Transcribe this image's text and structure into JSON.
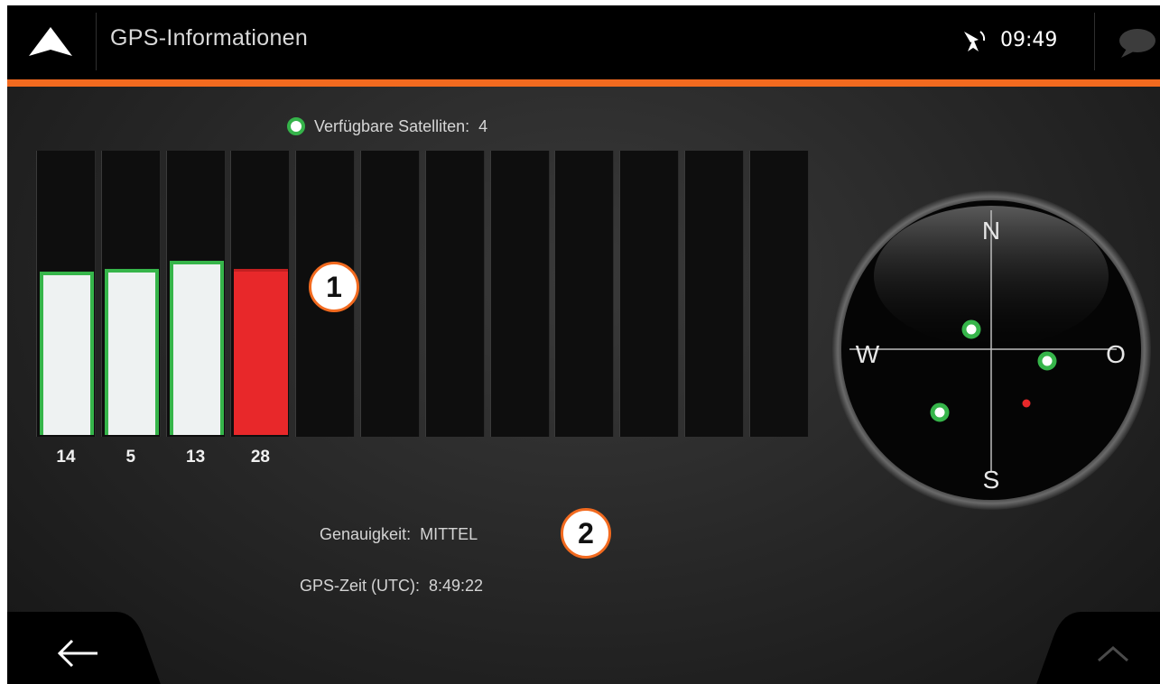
{
  "header": {
    "title": "GPS-Informationen",
    "clock": "09:49",
    "nav_icon": "navigation-arrow-icon",
    "satellite_icon": "satellite-icon",
    "message_icon": "speech-bubble-icon",
    "accent_color": "#f26a1f"
  },
  "satellites": {
    "available_label": "Verfügbare Satelliten:",
    "available_count": "4",
    "bars": [
      {
        "id": "14",
        "strength": 0.57,
        "status": "good"
      },
      {
        "id": "5",
        "strength": 0.58,
        "status": "good"
      },
      {
        "id": "13",
        "strength": 0.61,
        "status": "good"
      },
      {
        "id": "28",
        "strength": 0.58,
        "status": "weak"
      }
    ],
    "empty_slots": 8,
    "good_color": "#36b54a",
    "weak_color": "#e8282a"
  },
  "callouts": {
    "one": "1",
    "two": "2"
  },
  "compass": {
    "north": "N",
    "south": "S",
    "west": "W",
    "east": "O"
  },
  "info": {
    "accuracy_label": "Genauigkeit:",
    "accuracy_value": "MITTEL",
    "time_label": "GPS-Zeit (UTC):",
    "time_value": "8:49:22"
  },
  "footer": {
    "back_icon": "back-arrow-icon",
    "up_icon": "chevron-up-icon"
  }
}
